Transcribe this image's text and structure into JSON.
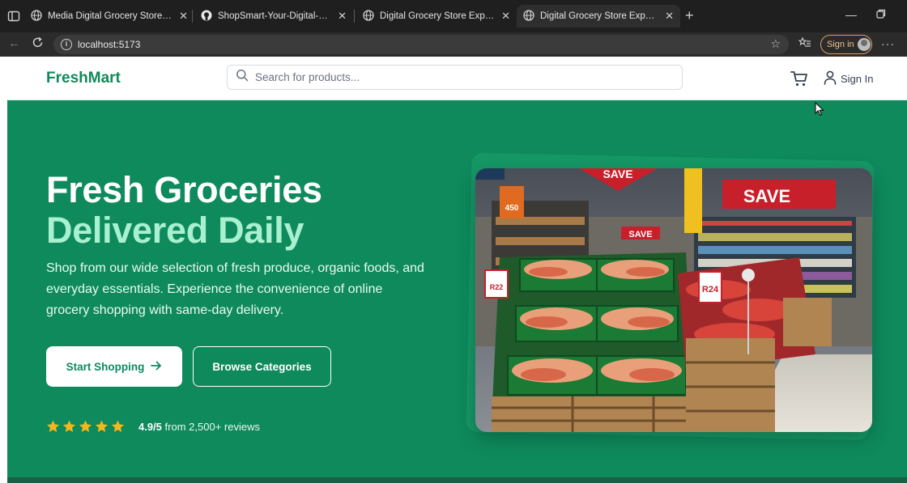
{
  "browser": {
    "tabs": [
      {
        "title": "Media Digital Grocery Store Experience",
        "active": false
      },
      {
        "title": "ShopSmart-Your-Digital-Grocery-",
        "active": false
      },
      {
        "title": "Digital Grocery Store Experience",
        "active": false
      },
      {
        "title": "Digital Grocery Store Experience",
        "active": true
      }
    ],
    "url": "localhost:5173",
    "profile_label": "Sign in"
  },
  "header": {
    "logo": "FreshMart",
    "search_placeholder": "Search for products...",
    "signin_label": "Sign In"
  },
  "hero": {
    "title_line1": "Fresh Groceries",
    "title_line2": "Delivered Daily",
    "description": "Shop from our wide selection of fresh produce, organic foods, and everyday essentials. Experience the convenience of online grocery shopping with same-day delivery.",
    "primary_button": "Start Shopping",
    "secondary_button": "Browse Categories",
    "rating_value": "4.9/5",
    "rating_text": "from 2,500+ reviews",
    "stars": 5,
    "image_signs": {
      "save1": "SAVE",
      "save2": "SAVE",
      "save3": "SAVE",
      "price1": "450",
      "price2": "R24",
      "price3": "R22"
    }
  },
  "colors": {
    "brand": "#0e8a5d",
    "accent": "#a8f0cf",
    "star": "#f5b81c"
  }
}
